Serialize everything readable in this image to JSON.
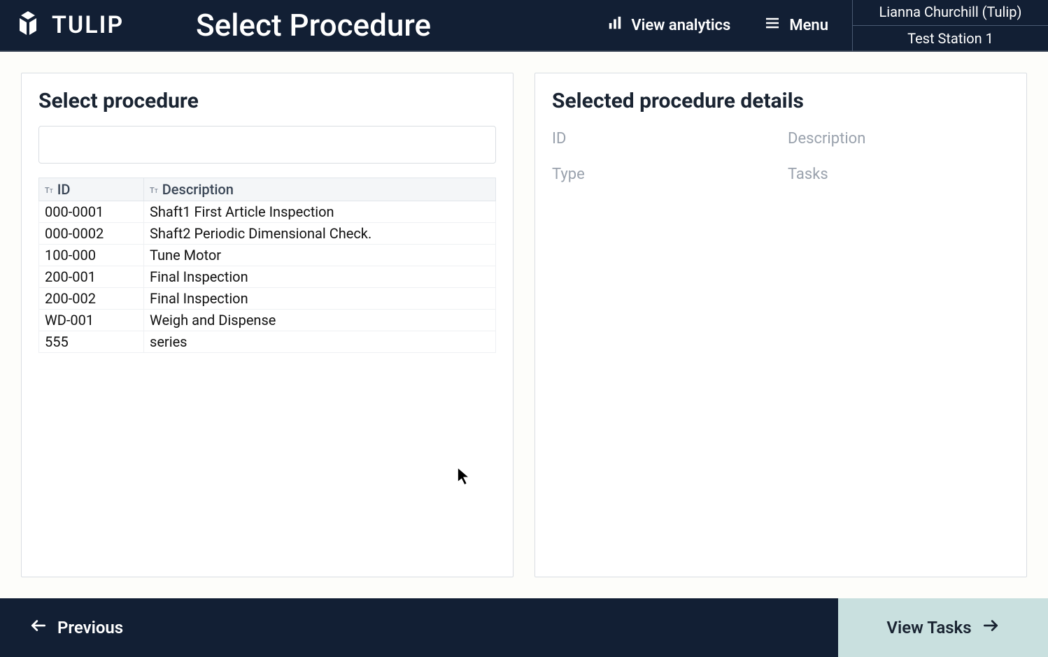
{
  "header": {
    "brand": "TULIP",
    "title": "Select Procedure",
    "analytics_label": "View analytics",
    "menu_label": "Menu",
    "user": "Lianna Churchill (Tulip)",
    "station": "Test Station 1"
  },
  "left_panel": {
    "title": "Select procedure",
    "search_value": "",
    "columns": {
      "id": "ID",
      "description": "Description"
    },
    "rows": [
      {
        "id": "000-0001",
        "description": "Shaft1 First Article Inspection"
      },
      {
        "id": "000-0002",
        "description": "Shaft2 Periodic Dimensional Check."
      },
      {
        "id": "100-000",
        "description": "Tune Motor"
      },
      {
        "id": "200-001",
        "description": "Final Inspection"
      },
      {
        "id": "200-002",
        "description": "Final Inspection"
      },
      {
        "id": "WD-001",
        "description": "Weigh and Dispense"
      },
      {
        "id": "555",
        "description": "series"
      }
    ]
  },
  "right_panel": {
    "title": "Selected procedure details",
    "labels": {
      "id": "ID",
      "description": "Description",
      "type": "Type",
      "tasks": "Tasks"
    }
  },
  "footer": {
    "previous": "Previous",
    "view_tasks": "View Tasks"
  }
}
